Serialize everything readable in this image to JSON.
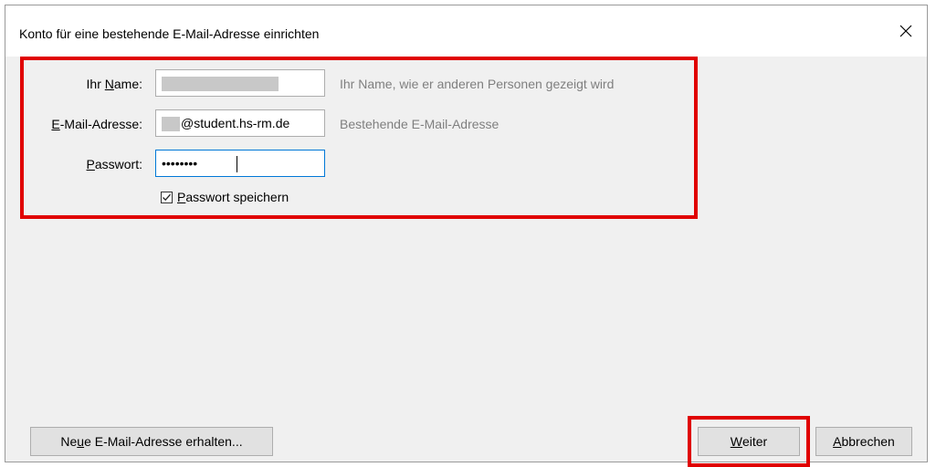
{
  "dialog": {
    "title": "Konto für eine bestehende E-Mail-Adresse einrichten"
  },
  "form": {
    "name": {
      "label_underline": "N",
      "label_pre": "Ihr ",
      "label_post": "ame:",
      "hint": "Ihr Name, wie er anderen Personen gezeigt wird"
    },
    "email": {
      "label_underline": "E",
      "label_post": "-Mail-Adresse:",
      "value_suffix": "@student.hs-rm.de",
      "hint": "Bestehende E-Mail-Adresse"
    },
    "password": {
      "label_underline": "P",
      "label_post": "asswort:",
      "value": "••••••••"
    },
    "save_password": {
      "checked": true,
      "label_underline": "P",
      "label_post": "asswort speichern"
    }
  },
  "buttons": {
    "new_address": {
      "label_pre": "Ne",
      "label_underline": "u",
      "label_post": "e E-Mail-Adresse erhalten..."
    },
    "next": {
      "label_underline": "W",
      "label_post": "eiter"
    },
    "cancel": {
      "label_underline": "A",
      "label_post": "bbrechen"
    }
  },
  "colors": {
    "highlight": "#e00000",
    "focus": "#0078d7",
    "hint": "#7f7f7f"
  }
}
